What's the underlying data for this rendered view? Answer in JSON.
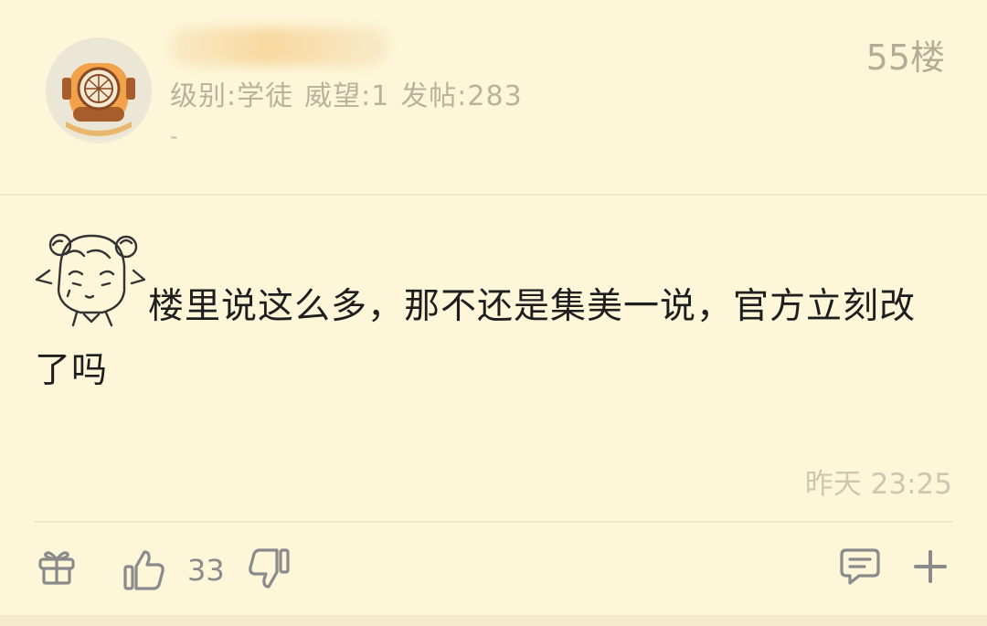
{
  "post": {
    "floor": "55楼",
    "user": {
      "level_text": "级别:学徒",
      "prestige_text": "威望:1",
      "posts_text": "发帖:283",
      "signature": "-"
    },
    "content": {
      "line1": "楼里说这么多，那不还是集美一说，官方立刻改",
      "line2": "了吗"
    },
    "time": "昨天 23:25",
    "actions": {
      "like_count": "33"
    },
    "colors": {
      "background": "#fdf6d9",
      "divider": "#efe6c6",
      "icon": "#8a8a8a",
      "meta_text": "#b9b29c"
    }
  }
}
